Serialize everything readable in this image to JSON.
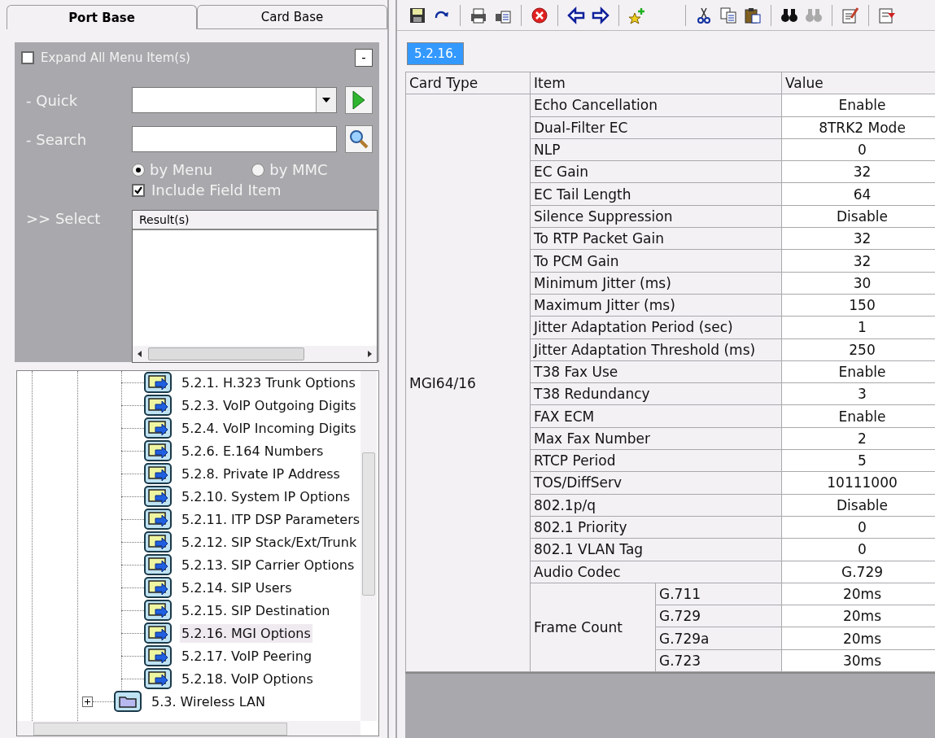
{
  "tabs": [
    {
      "label": "Port Base",
      "selected": true
    },
    {
      "label": "Card Base",
      "selected": false
    }
  ],
  "filter": {
    "expand_all": {
      "label": "Expand All Menu Item(s)",
      "checked": false
    },
    "collapse_button": "-",
    "quick_label": "- Quick",
    "search_label": "- Search",
    "radios": [
      {
        "label": "by Menu",
        "selected": true
      },
      {
        "label": "by MMC",
        "selected": false
      }
    ],
    "include_field": {
      "label": "Include Field Item",
      "checked": true
    },
    "select_label": ">> Select",
    "results_header": "Result(s)"
  },
  "tree": {
    "items": [
      {
        "children": [
          {
            "label": "5.2.1. H.323 Trunk Options",
            "kind": "page",
            "selected": false
          },
          {
            "label": "5.2.3. VoIP Outgoing Digits",
            "kind": "page",
            "selected": false
          },
          {
            "label": "5.2.4. VoIP Incoming Digits",
            "kind": "page",
            "selected": false
          },
          {
            "label": "5.2.6. E.164 Numbers",
            "kind": "page",
            "selected": false
          },
          {
            "label": "5.2.8. Private IP Address",
            "kind": "page",
            "selected": false
          },
          {
            "label": "5.2.10. System IP Options",
            "kind": "page",
            "selected": false
          },
          {
            "label": "5.2.11. ITP DSP Parameters",
            "kind": "page",
            "selected": false
          },
          {
            "label": "5.2.12. SIP Stack/Ext/Trunk",
            "kind": "page",
            "selected": false
          },
          {
            "label": "5.2.13. SIP Carrier Options",
            "kind": "page",
            "selected": false
          },
          {
            "label": "5.2.14. SIP Users",
            "kind": "page",
            "selected": false
          },
          {
            "label": "5.2.15. SIP Destination",
            "kind": "page",
            "selected": false
          },
          {
            "label": "5.2.16. MGI Options",
            "kind": "page",
            "selected": true
          },
          {
            "label": "5.2.17. VoIP Peering",
            "kind": "page",
            "selected": false
          },
          {
            "label": "5.2.18. VoIP Options",
            "kind": "page",
            "selected": false
          }
        ]
      },
      {
        "label": "5.3. Wireless LAN",
        "kind": "folder",
        "expanded": false,
        "selected": false
      }
    ]
  },
  "breadcrumb": "5.2.16.",
  "table": {
    "columns": [
      "Card Type",
      "Item",
      "Value"
    ],
    "card_type": "MGI64/16",
    "rows": [
      {
        "kind": "single",
        "item": "Echo Cancellation",
        "value": "Enable"
      },
      {
        "kind": "single",
        "item": "Dual-Filter EC",
        "value": "8TRK2 Mode"
      },
      {
        "kind": "single",
        "item": "NLP",
        "value": "0"
      },
      {
        "kind": "single",
        "item": "EC Gain",
        "value": "32"
      },
      {
        "kind": "single",
        "item": "EC Tail Length",
        "value": "64"
      },
      {
        "kind": "single",
        "item": "Silence Suppression",
        "value": "Disable"
      },
      {
        "kind": "single",
        "item": "To RTP Packet Gain",
        "value": "32"
      },
      {
        "kind": "single",
        "item": "To PCM Gain",
        "value": "32"
      },
      {
        "kind": "single",
        "item": "Minimum Jitter (ms)",
        "value": "30"
      },
      {
        "kind": "single",
        "item": "Maximum Jitter (ms)",
        "value": "150"
      },
      {
        "kind": "single",
        "item": "Jitter Adaptation Period (sec)",
        "value": "1"
      },
      {
        "kind": "single",
        "item": "Jitter Adaptation Threshold (ms)",
        "value": "250"
      },
      {
        "kind": "single",
        "item": "T38 Fax Use",
        "value": "Enable"
      },
      {
        "kind": "single",
        "item": "T38 Redundancy",
        "value": "3"
      },
      {
        "kind": "single",
        "item": "FAX ECM",
        "value": "Enable"
      },
      {
        "kind": "single",
        "item": "Max Fax Number",
        "value": "2"
      },
      {
        "kind": "single",
        "item": "RTCP Period",
        "value": "5"
      },
      {
        "kind": "single",
        "item": "TOS/DiffServ",
        "value": "10111000"
      },
      {
        "kind": "single",
        "item": "802.1p/q",
        "value": "Disable"
      },
      {
        "kind": "single",
        "item": "802.1 Priority",
        "value": "0"
      },
      {
        "kind": "single",
        "item": "802.1 VLAN Tag",
        "value": "0"
      },
      {
        "kind": "single",
        "item": "Audio Codec",
        "value": "G.729"
      },
      {
        "kind": "group",
        "item": "Frame Count",
        "children": [
          {
            "item": "G.711",
            "value": "20ms"
          },
          {
            "item": "G.729",
            "value": "20ms"
          },
          {
            "item": "G.729a",
            "value": "20ms"
          },
          {
            "item": "G.723",
            "value": "30ms"
          }
        ]
      }
    ]
  }
}
